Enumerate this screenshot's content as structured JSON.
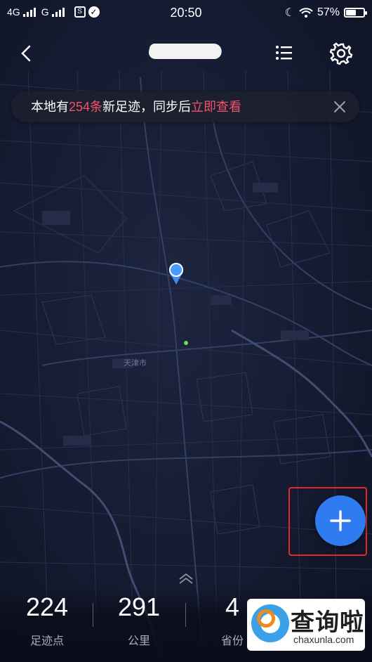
{
  "status_bar": {
    "network_1": "4G",
    "network_2": "G",
    "time": "20:50",
    "battery_percent": "57%",
    "battery_level": 0.57
  },
  "header": {
    "back_icon": "chevron-left-icon",
    "title": "",
    "list_icon": "list-icon",
    "settings_icon": "gear-icon"
  },
  "notice": {
    "prefix": "本地有",
    "count": "254条",
    "middle": "新足迹，同步后",
    "action": "立即查看",
    "close_icon": "close-icon",
    "highlight_color": "#f2526a"
  },
  "map": {
    "labels": [
      "天津市"
    ]
  },
  "fab": {
    "icon": "plus-icon",
    "color": "#2f7bf2"
  },
  "stats": [
    {
      "value": "224",
      "label": "足迹点"
    },
    {
      "value": "291",
      "label": "公里"
    },
    {
      "value": "4",
      "label": "省份"
    }
  ],
  "watermark": {
    "title": "查询啦",
    "url": "chaxunla.com"
  }
}
